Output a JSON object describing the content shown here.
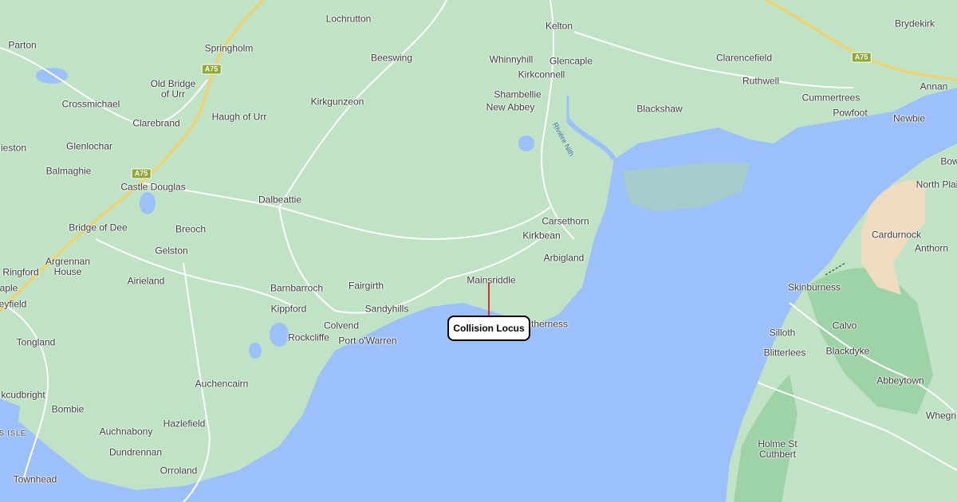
{
  "map": {
    "places": [
      {
        "name": "Parton",
        "id": "parton"
      },
      {
        "name": "Springholm",
        "id": "springholm"
      },
      {
        "name": "Lochrutton",
        "id": "lochrutton"
      },
      {
        "name": "Beeswing",
        "id": "beeswing"
      },
      {
        "name": "Kelton",
        "id": "kelton"
      },
      {
        "name": "Whinnyhill",
        "id": "whinnyhill"
      },
      {
        "name": "Glencaple",
        "id": "glencaple"
      },
      {
        "name": "Clarencefield",
        "id": "clarencefield"
      },
      {
        "name": "Brydekirk",
        "id": "brydekirk"
      },
      {
        "name": "Annan",
        "id": "annan"
      },
      {
        "name": "Old Bridge\nof Urr",
        "id": "old-bridge-of-urr"
      },
      {
        "name": "Crossmichael",
        "id": "crossmichael"
      },
      {
        "name": "Haugh of Urr",
        "id": "haugh-of-urr"
      },
      {
        "name": "Kirkgunzeon",
        "id": "kirkgunzeon"
      },
      {
        "name": "Kirkconnell",
        "id": "kirkconnell"
      },
      {
        "name": "Shambellie",
        "id": "shambellie"
      },
      {
        "name": "New Abbey",
        "id": "new-abbey"
      },
      {
        "name": "Ruthwell",
        "id": "ruthwell"
      },
      {
        "name": "Cummertrees",
        "id": "cummertrees"
      },
      {
        "name": "Blackshaw",
        "id": "blackshaw"
      },
      {
        "name": "Powfoot",
        "id": "powfoot"
      },
      {
        "name": "Newbie",
        "id": "newbie"
      },
      {
        "name": "Clarebrand",
        "id": "clarebrand"
      },
      {
        "name": "ieston",
        "id": "ieston"
      },
      {
        "name": "Glenlochar",
        "id": "glenlochar"
      },
      {
        "name": "Balmaghie",
        "id": "balmaghie"
      },
      {
        "name": "Castle Douglas",
        "id": "castle-douglas"
      },
      {
        "name": "Dalbeattie",
        "id": "dalbeattie"
      },
      {
        "name": "Bow",
        "id": "bow"
      },
      {
        "name": "North Plai",
        "id": "north-plain"
      },
      {
        "name": "Carsethorn",
        "id": "carsethorn"
      },
      {
        "name": "Bridge of Dee",
        "id": "bridge-of-dee"
      },
      {
        "name": "Breoch",
        "id": "breoch"
      },
      {
        "name": "Kirkbean",
        "id": "kirkbean"
      },
      {
        "name": "Cardurnock",
        "id": "cardurnock"
      },
      {
        "name": "Arbigland",
        "id": "arbigland"
      },
      {
        "name": "Anthorn",
        "id": "anthorn"
      },
      {
        "name": "Gelston",
        "id": "gelston"
      },
      {
        "name": "Ringford",
        "id": "ringford"
      },
      {
        "name": "Argrennan\nHouse",
        "id": "argrennan-house"
      },
      {
        "name": "Airieland",
        "id": "airieland"
      },
      {
        "name": "Mainsriddle",
        "id": "mainsriddle"
      },
      {
        "name": "Barnbarroch",
        "id": "barnbarroch"
      },
      {
        "name": "Fairgirth",
        "id": "fairgirth"
      },
      {
        "name": "Skinburness",
        "id": "skinburness"
      },
      {
        "name": "aple",
        "id": "aple"
      },
      {
        "name": "eyfield",
        "id": "eyfield"
      },
      {
        "name": "Kippford",
        "id": "kippford"
      },
      {
        "name": "Sandyhills",
        "id": "sandyhills"
      },
      {
        "name": "therness",
        "id": "southerness"
      },
      {
        "name": "Colvend",
        "id": "colvend"
      },
      {
        "name": "Calvo",
        "id": "calvo"
      },
      {
        "name": "Silloth",
        "id": "silloth"
      },
      {
        "name": "Rockcliffe",
        "id": "rockcliffe"
      },
      {
        "name": "Port o'Warren",
        "id": "port-o-warren"
      },
      {
        "name": "Tongland",
        "id": "tongland"
      },
      {
        "name": "Blitterlees",
        "id": "blitterlees"
      },
      {
        "name": "Blackdyke",
        "id": "blackdyke"
      },
      {
        "name": "Abbeytown",
        "id": "abbeytown"
      },
      {
        "name": "Auchencairn",
        "id": "auchencairn"
      },
      {
        "name": "kcudbright",
        "id": "kirkcudbright"
      },
      {
        "name": "Bombie",
        "id": "bombie"
      },
      {
        "name": "Whegri",
        "id": "whegri"
      },
      {
        "name": "Hazlefield",
        "id": "hazlefield"
      },
      {
        "name": "S ISLE",
        "id": "s-isle"
      },
      {
        "name": "Auchnabony",
        "id": "auchnabony"
      },
      {
        "name": "Holme St\nCuthbert",
        "id": "holme-st-cuthbert"
      },
      {
        "name": "Dundrennan",
        "id": "dundrennan"
      },
      {
        "name": "Orroland",
        "id": "orroland"
      },
      {
        "name": "Townhead",
        "id": "townhead"
      }
    ],
    "road_shields": [
      {
        "label": "A75",
        "id": "a75-north"
      },
      {
        "label": "A75",
        "id": "a75-east"
      },
      {
        "label": "A75",
        "id": "a75-west"
      }
    ],
    "river_label": "Rivière Nith",
    "callout": {
      "label": "Collision Locus"
    },
    "colors": {
      "land": "#bfe3c4",
      "water": "#9cc0f9",
      "road": "#ffffff",
      "highway": "#f6cf65",
      "callout_line": "#d32f2f"
    }
  }
}
